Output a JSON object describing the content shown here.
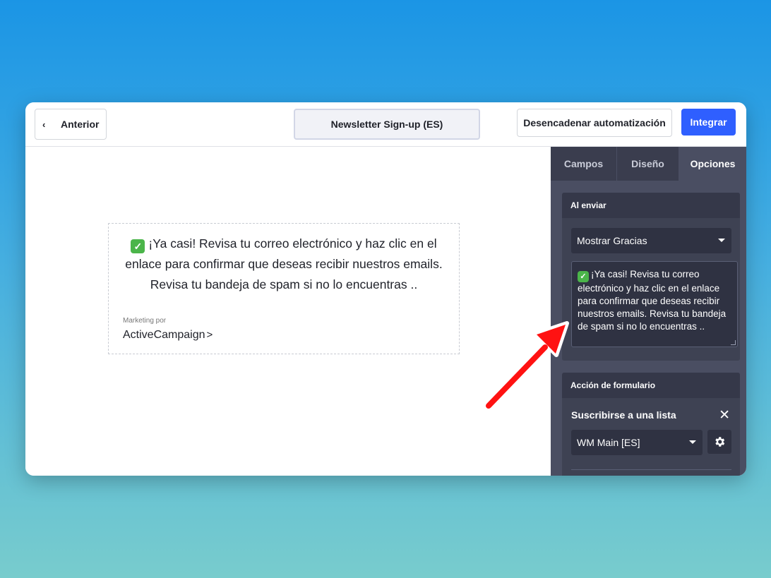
{
  "header": {
    "back_label": "Anterior",
    "form_title": "Newsletter Sign-up (ES)",
    "trigger_label": "Desencadenar automatización",
    "integrate_label": "Integrar"
  },
  "preview": {
    "check_emoji": "✓",
    "message": "¡Ya casi! Revisa tu correo electrónico y haz clic en el enlace para confirmar que deseas recibir nuestros emails. Revisa tu bandeja de spam si no lo encuentras ..",
    "marketing_by": "Marketing por",
    "brand": "ActiveCampaign",
    "brand_chevron": ">"
  },
  "sidebar": {
    "tabs": [
      {
        "label": "Campos"
      },
      {
        "label": "Diseño"
      },
      {
        "label": "Opciones",
        "active": true
      }
    ],
    "on_submit": {
      "heading": "Al enviar",
      "selected": "Mostrar Gracias",
      "message": "¡Ya casi! Revisa tu correo electrónico y haz clic en el enlace para confirmar que deseas recibir nuestros emails. Revisa tu bandeja de spam si no lo encuentras .."
    },
    "form_action": {
      "heading": "Acción de formulario",
      "action_title": "Suscribirse a una lista",
      "close_glyph": "✕",
      "list_selected": "WM Main [ES]"
    }
  },
  "colors": {
    "accent": "#2f5fff",
    "sidebar_bg": "#4a4e62",
    "check_green": "#4bb54a",
    "arrow_red": "#ff1212"
  }
}
